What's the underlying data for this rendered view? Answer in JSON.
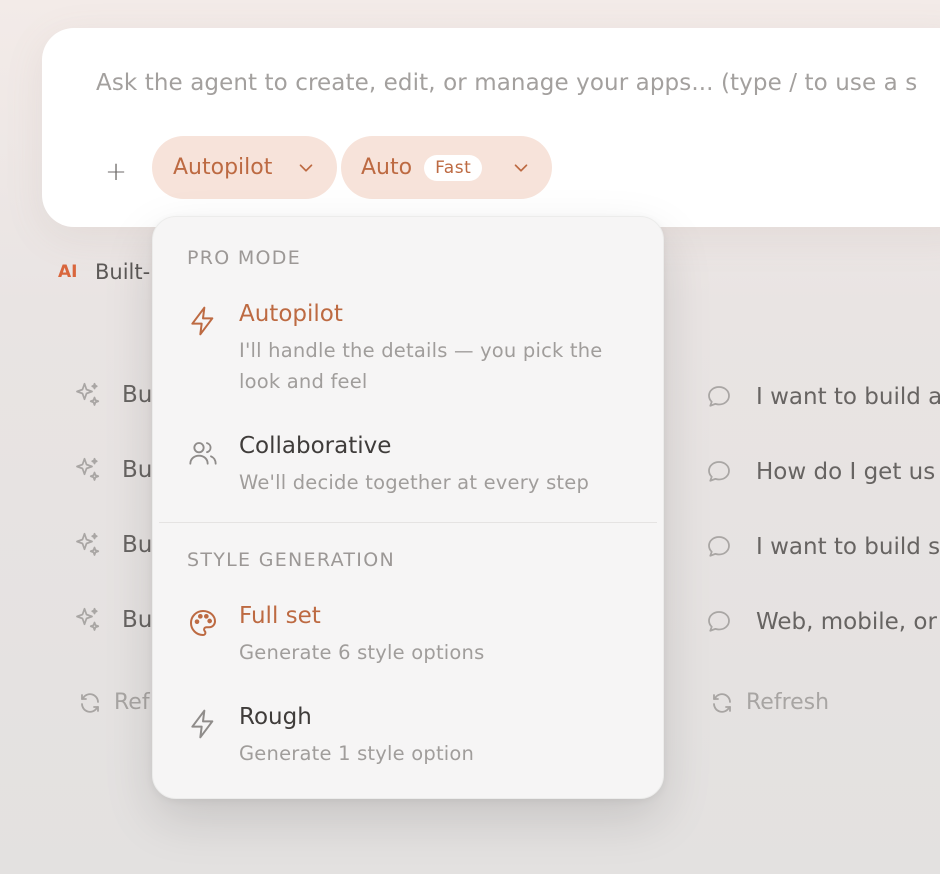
{
  "composer": {
    "placeholder": "Ask the agent to create, edit, or manage your apps... (type / to use a s",
    "plus": "+",
    "mode_pill": {
      "label": "Autopilot"
    },
    "model_pill": {
      "label": "Auto",
      "badge": "Fast"
    }
  },
  "builtin": {
    "tag": "AI",
    "text": "Built-"
  },
  "suggestions_left": [
    {
      "icon": "sparkle-icon",
      "text": "Bu"
    },
    {
      "icon": "sparkle-icon",
      "text": "Bu"
    },
    {
      "icon": "sparkle-icon",
      "text": "Bu"
    },
    {
      "icon": "sparkle-icon",
      "text": "Bu"
    }
  ],
  "suggestions_right": [
    {
      "icon": "chat-bubble-icon",
      "text": "I want to build a"
    },
    {
      "icon": "chat-bubble-icon",
      "text": "How do I get us"
    },
    {
      "icon": "chat-bubble-icon",
      "text": "I want to build s"
    },
    {
      "icon": "chat-bubble-icon",
      "text": "Web, mobile, or"
    }
  ],
  "refresh": {
    "left_label": "Ref",
    "right_label": "Refresh"
  },
  "dropdown": {
    "pro_mode_header": "PRO MODE",
    "pro_mode_options": [
      {
        "title": "Autopilot",
        "desc": "I'll handle the details — you pick the look and feel",
        "icon": "lightning-icon",
        "active": true
      },
      {
        "title": "Collaborative",
        "desc": "We'll decide together at every step",
        "icon": "users-icon",
        "active": false
      }
    ],
    "style_header": "STYLE GENERATION",
    "style_options": [
      {
        "title": "Full set",
        "desc": "Generate 6 style options",
        "icon": "palette-icon",
        "active": true
      },
      {
        "title": "Rough",
        "desc": "Generate 1 style option",
        "icon": "lightning-icon",
        "active": false
      }
    ]
  },
  "colors": {
    "accent": "#bd6a42",
    "pill_bg": "#f7e3da",
    "ai_tag": "#d9663d"
  }
}
